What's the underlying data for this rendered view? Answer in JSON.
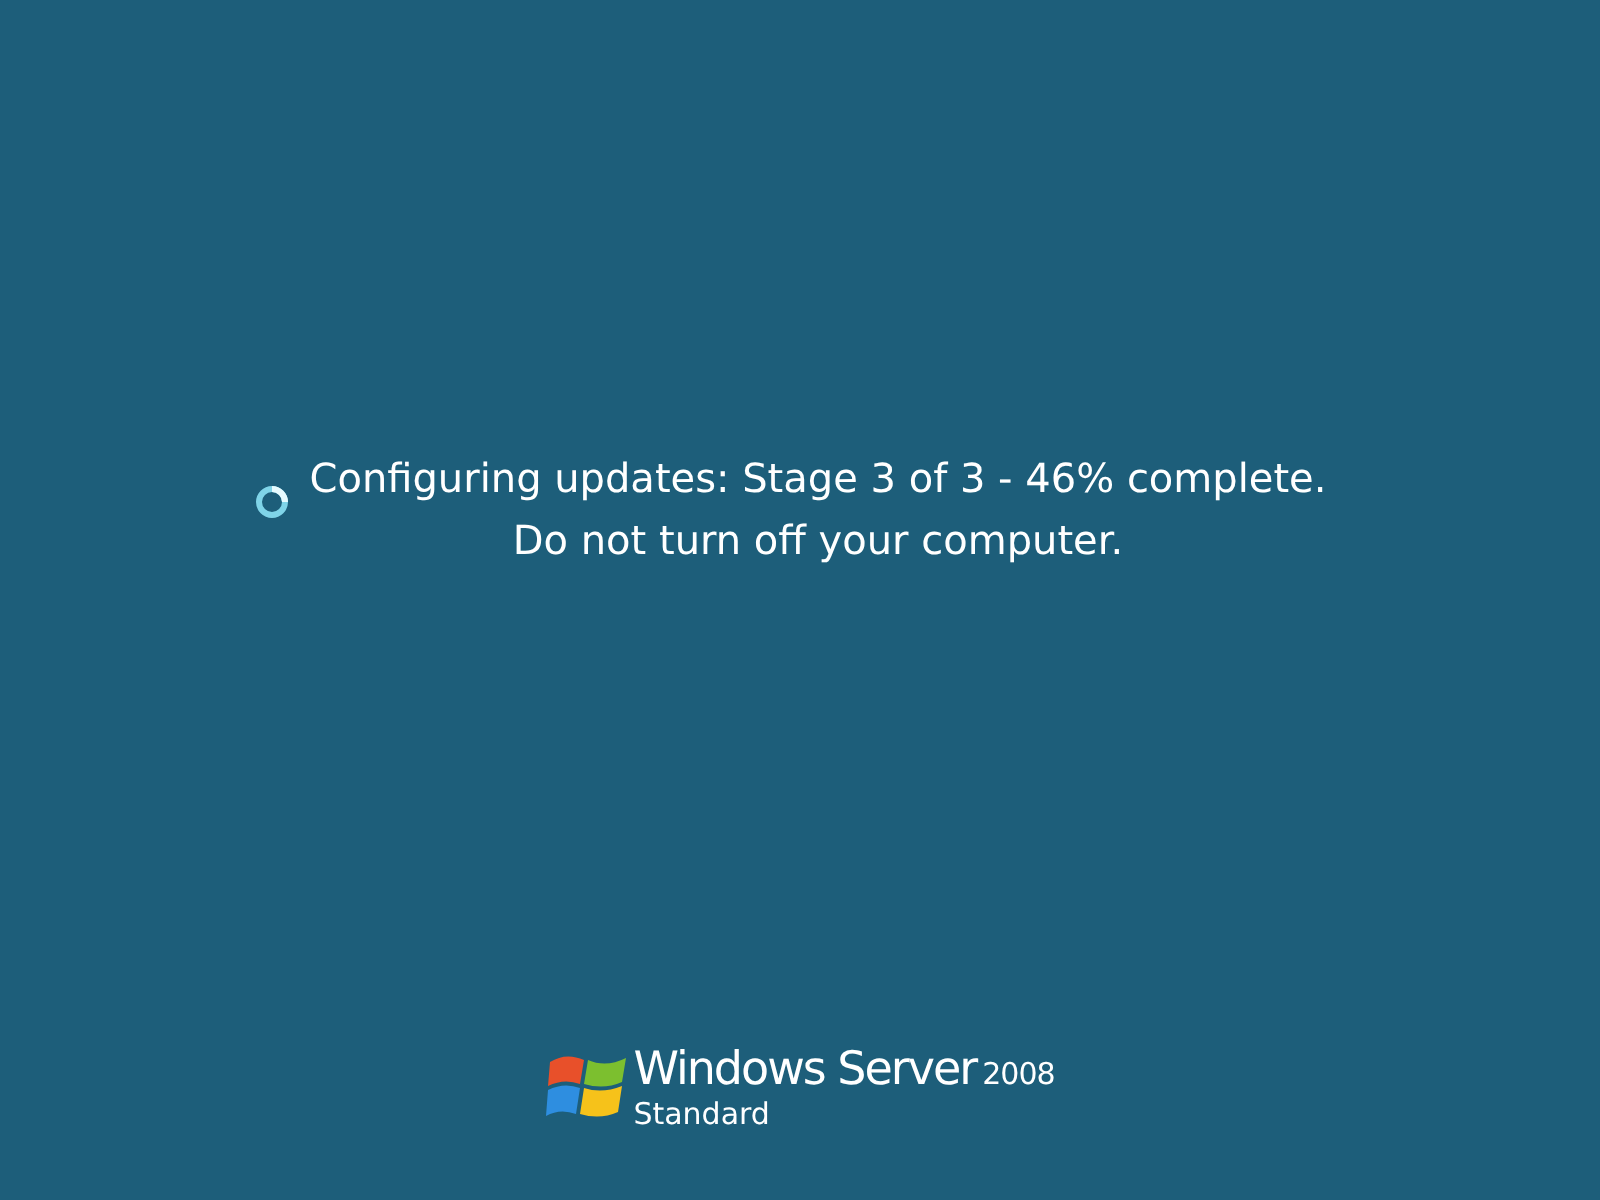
{
  "status": {
    "lines": [
      "Configuring updates: Stage 3 of 3 - 46% complete.",
      "Do not turn off your computer."
    ]
  },
  "branding": {
    "product": "Windows Server",
    "version": "2008",
    "edition": "Standard"
  }
}
